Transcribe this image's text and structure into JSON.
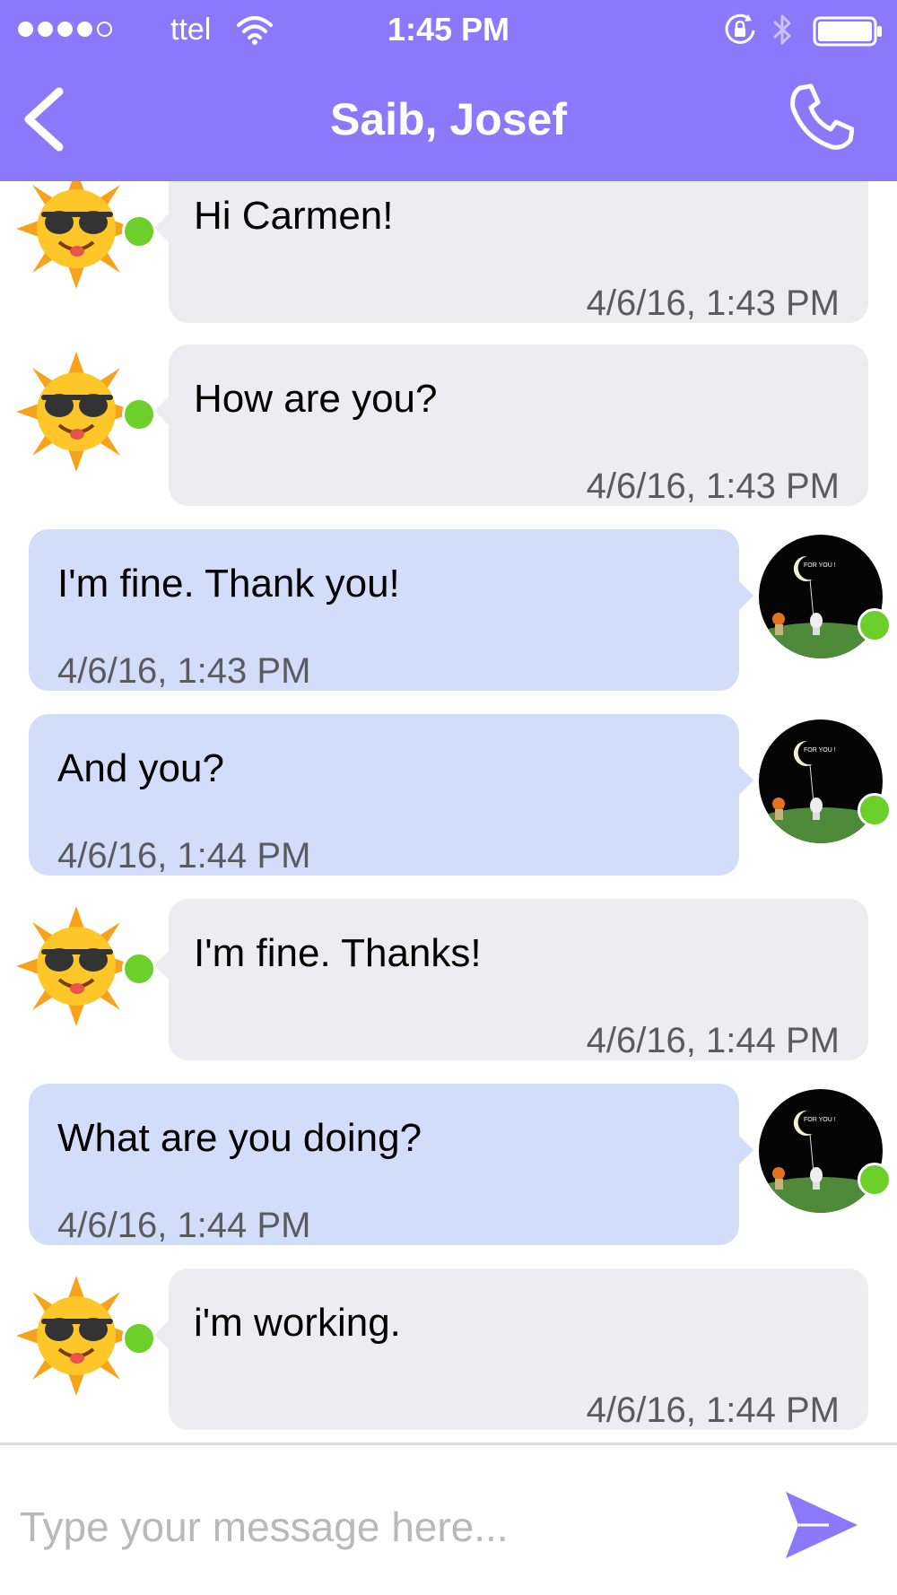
{
  "status_bar": {
    "carrier": "ttel",
    "time": "1:45 PM",
    "signal_bars_filled": 4,
    "signal_bars_total": 5
  },
  "header": {
    "title": "Saib, Josef",
    "back_icon": "chevron-left-icon",
    "call_icon": "phone-icon",
    "background_color": "#8b78fa"
  },
  "messages": [
    {
      "direction": "incoming",
      "avatar": "sun-sunglasses-avatar",
      "text": "Hi Carmen!",
      "time": "4/6/16, 1:43 PM",
      "online": true
    },
    {
      "direction": "incoming",
      "avatar": "sun-sunglasses-avatar",
      "text": "How are you?",
      "time": "4/6/16, 1:43 PM",
      "online": true
    },
    {
      "direction": "outgoing",
      "avatar": "moon-night-avatar",
      "text": "I'm fine. Thank you!",
      "time": "4/6/16, 1:43 PM",
      "online": true
    },
    {
      "direction": "outgoing",
      "avatar": "moon-night-avatar",
      "text": "And you?",
      "time": "4/6/16, 1:44 PM",
      "online": true
    },
    {
      "direction": "incoming",
      "avatar": "sun-sunglasses-avatar",
      "text": "I'm fine. Thanks!",
      "time": "4/6/16, 1:44 PM",
      "online": true
    },
    {
      "direction": "outgoing",
      "avatar": "moon-night-avatar",
      "text": "What are you doing?",
      "time": "4/6/16, 1:44 PM",
      "online": true
    },
    {
      "direction": "incoming",
      "avatar": "sun-sunglasses-avatar",
      "text": "i'm working.",
      "time": "4/6/16, 1:44 PM",
      "online": true
    }
  ],
  "composer": {
    "placeholder": "Type your message here...",
    "value": "",
    "send_icon": "send-arrow-icon"
  },
  "colors": {
    "accent": "#8b78fa",
    "incoming_bubble": "#ececf1",
    "outgoing_bubble": "#d2def9",
    "online": "#6ccf2a"
  },
  "avatar_text": {
    "moon_caption": "FOR YOU !"
  }
}
